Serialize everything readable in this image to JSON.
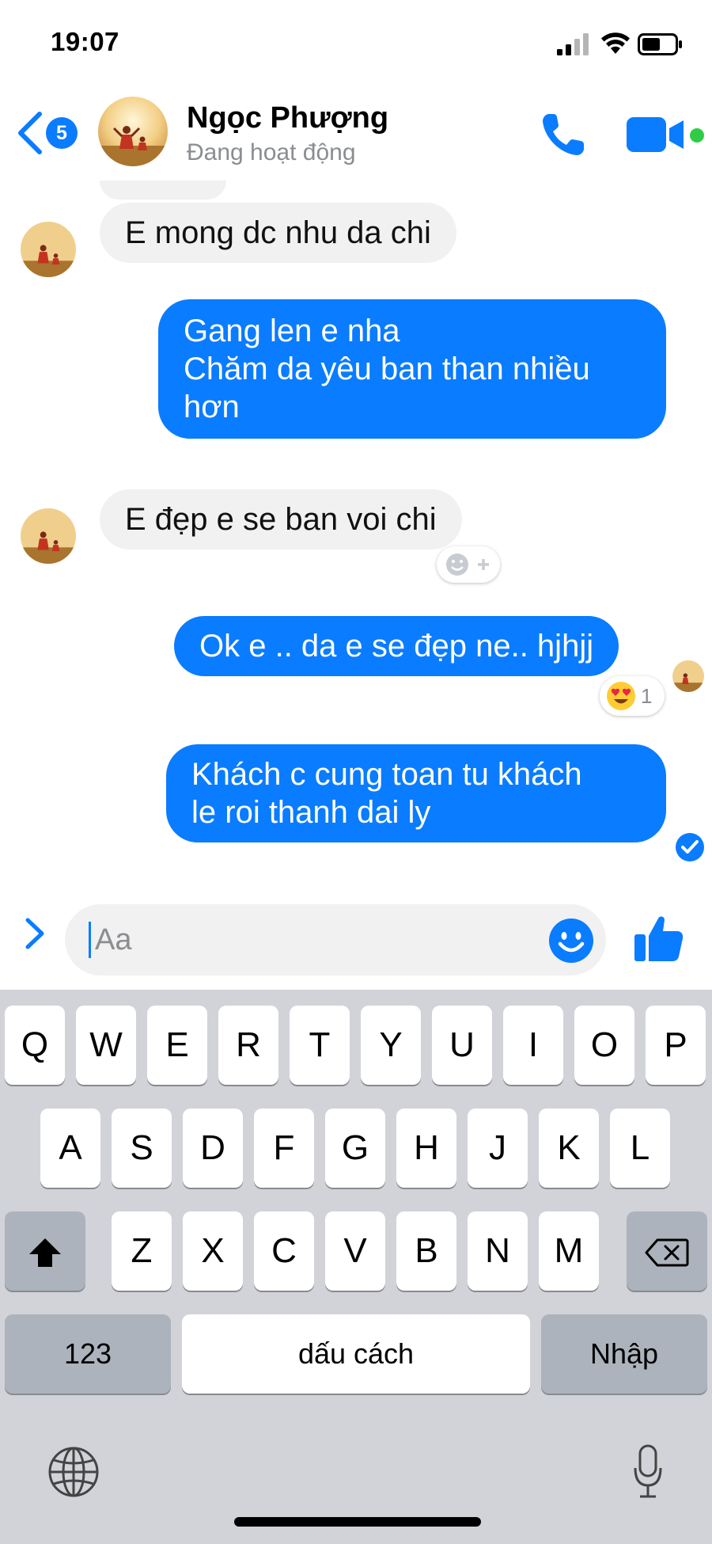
{
  "status_bar": {
    "time": "19:07"
  },
  "header": {
    "back_badge": "5",
    "contact_name": "Ngọc Phượng",
    "contact_status": "Đang hoạt động"
  },
  "messages": [
    {
      "direction": "incoming",
      "lines": [
        "E mong dc nhu da chi"
      ]
    },
    {
      "direction": "outgoing",
      "lines": [
        "Gang len e nha",
        "Chăm da yêu ban than nhiều",
        "hơn"
      ]
    },
    {
      "direction": "incoming",
      "lines": [
        "E đẹp e se ban voi chi"
      ]
    },
    {
      "direction": "outgoing",
      "lines": [
        "Ok e .. da e se đẹp ne.. hjhjj"
      ],
      "reaction": {
        "emoji": "heart-eyes-emoji",
        "count": "1"
      }
    },
    {
      "direction": "outgoing",
      "lines": [
        "Khách c cung toan tu khách",
        "le roi thanh dai ly"
      ],
      "status": "delivered"
    }
  ],
  "composer": {
    "placeholder": "Aa"
  },
  "keyboard": {
    "row1": [
      "Q",
      "W",
      "E",
      "R",
      "T",
      "Y",
      "U",
      "I",
      "O",
      "P"
    ],
    "row2": [
      "A",
      "S",
      "D",
      "F",
      "G",
      "H",
      "J",
      "K",
      "L"
    ],
    "row3": [
      "Z",
      "X",
      "C",
      "V",
      "B",
      "N",
      "M"
    ],
    "numbers_key": "123",
    "space_key": "dấu cách",
    "return_key": "Nhập"
  },
  "colors": {
    "accent": "#0a7cff",
    "incoming_bubble": "#f1f1f1",
    "online": "#31cc46",
    "keyboard_bg": "#d1d3d9"
  }
}
